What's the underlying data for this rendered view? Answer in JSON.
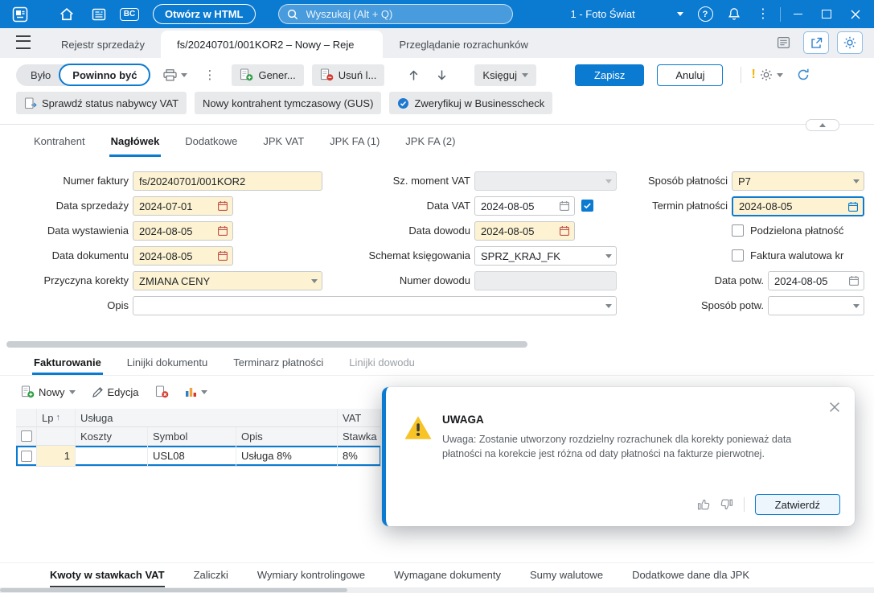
{
  "accent_color": "#0b7ad1",
  "icons": {
    "menu_dots": "⋮",
    "help": "?",
    "sort_asc": "↑"
  },
  "topbar": {
    "bc_badge": "BC",
    "open_html_button": "Otwórz w HTML",
    "search_placeholder": "Wyszukaj (Alt + Q)",
    "company_selector": "1 - Foto Świat"
  },
  "window_tabs": [
    {
      "label": "Rejestr sprzedaży"
    },
    {
      "label": "fs/20240701/001KOR2 – Nowy – Reje"
    },
    {
      "label": "Przeglądanie rozrachunków"
    }
  ],
  "toolbar": {
    "bylo": "Było",
    "powinno_byc": "Powinno być",
    "generuj": "Gener...",
    "usun": "Usuń l...",
    "ksieguj": "Księguj",
    "zapisz": "Zapisz",
    "anuluj": "Anuluj"
  },
  "toolbar_row2": {
    "sprawdz_vat": "Sprawdź status nabywcy VAT",
    "gus": "Nowy kontrahent tymczasowy (GUS)",
    "businesscheck": "Zweryfikuj w Businesscheck"
  },
  "form_tabs": [
    "Kontrahent",
    "Nagłówek",
    "Dodatkowe",
    "JPK VAT",
    "JPK FA (1)",
    "JPK FA (2)"
  ],
  "form": {
    "numer_faktury": {
      "label": "Numer faktury",
      "value": "fs/20240701/001KOR2"
    },
    "data_sprzedazy": {
      "label": "Data sprzedaży",
      "value": "2024-07-01"
    },
    "data_wystawienia": {
      "label": "Data wystawienia",
      "value": "2024-08-05"
    },
    "data_dokumentu": {
      "label": "Data dokumentu",
      "value": "2024-08-05"
    },
    "przyczyna_korekty": {
      "label": "Przyczyna korekty",
      "value": "ZMIANA CENY"
    },
    "opis": {
      "label": "Opis",
      "value": ""
    },
    "sz_moment_vat": {
      "label": "Sz. moment VAT",
      "value": ""
    },
    "data_vat": {
      "label": "Data VAT",
      "value": "2024-08-05"
    },
    "data_dowodu": {
      "label": "Data dowodu",
      "value": "2024-08-05"
    },
    "schemat_ksiegowania": {
      "label": "Schemat księgowania",
      "value": "SPRZ_KRAJ_FK"
    },
    "numer_dowodu": {
      "label": "Numer dowodu",
      "value": ""
    },
    "sposob_platnosci": {
      "label": "Sposób płatności",
      "value": "P7"
    },
    "termin_platnosci": {
      "label": "Termin płatności",
      "value": "2024-08-05"
    },
    "podzielona_platnosc": {
      "label": "Podzielona płatność"
    },
    "faktura_walutowa": {
      "label": "Faktura walutowa kr"
    },
    "data_potw": {
      "label": "Data potw.",
      "value": "2024-08-05"
    },
    "sposob_potw": {
      "label": "Sposób potw.",
      "value": ""
    }
  },
  "section_tabs": [
    "Fakturowanie",
    "Linijki dokumentu",
    "Terminarz płatności",
    "Linijki dowodu"
  ],
  "section_toolbar": {
    "nowy": "Nowy",
    "edycja": "Edycja"
  },
  "table": {
    "group_headers": {
      "lp": "Lp",
      "usluga": "Usługa",
      "vat": "VAT"
    },
    "columns": {
      "koszty": "Koszty",
      "symbol": "Symbol",
      "opis": "Opis",
      "stawka": "Stawka"
    },
    "rows": [
      {
        "lp": "1",
        "koszty": "",
        "symbol": "USL08",
        "opis": "Usługa 8%",
        "stawka": "8%"
      }
    ]
  },
  "dialog": {
    "title": "UWAGA",
    "message": "Uwaga: Zostanie utworzony rozdzielny rozrachunek dla korekty ponieważ data płatności na korekcie jest różna od daty płatności na fakturze pierwotnej.",
    "confirm_button": "Zatwierdź"
  },
  "bottom_tabs": [
    "Kwoty w stawkach VAT",
    "Zaliczki",
    "Wymiary kontrolingowe",
    "Wymagane dokumenty",
    "Sumy walutowe",
    "Dodatkowe dane dla JPK"
  ]
}
